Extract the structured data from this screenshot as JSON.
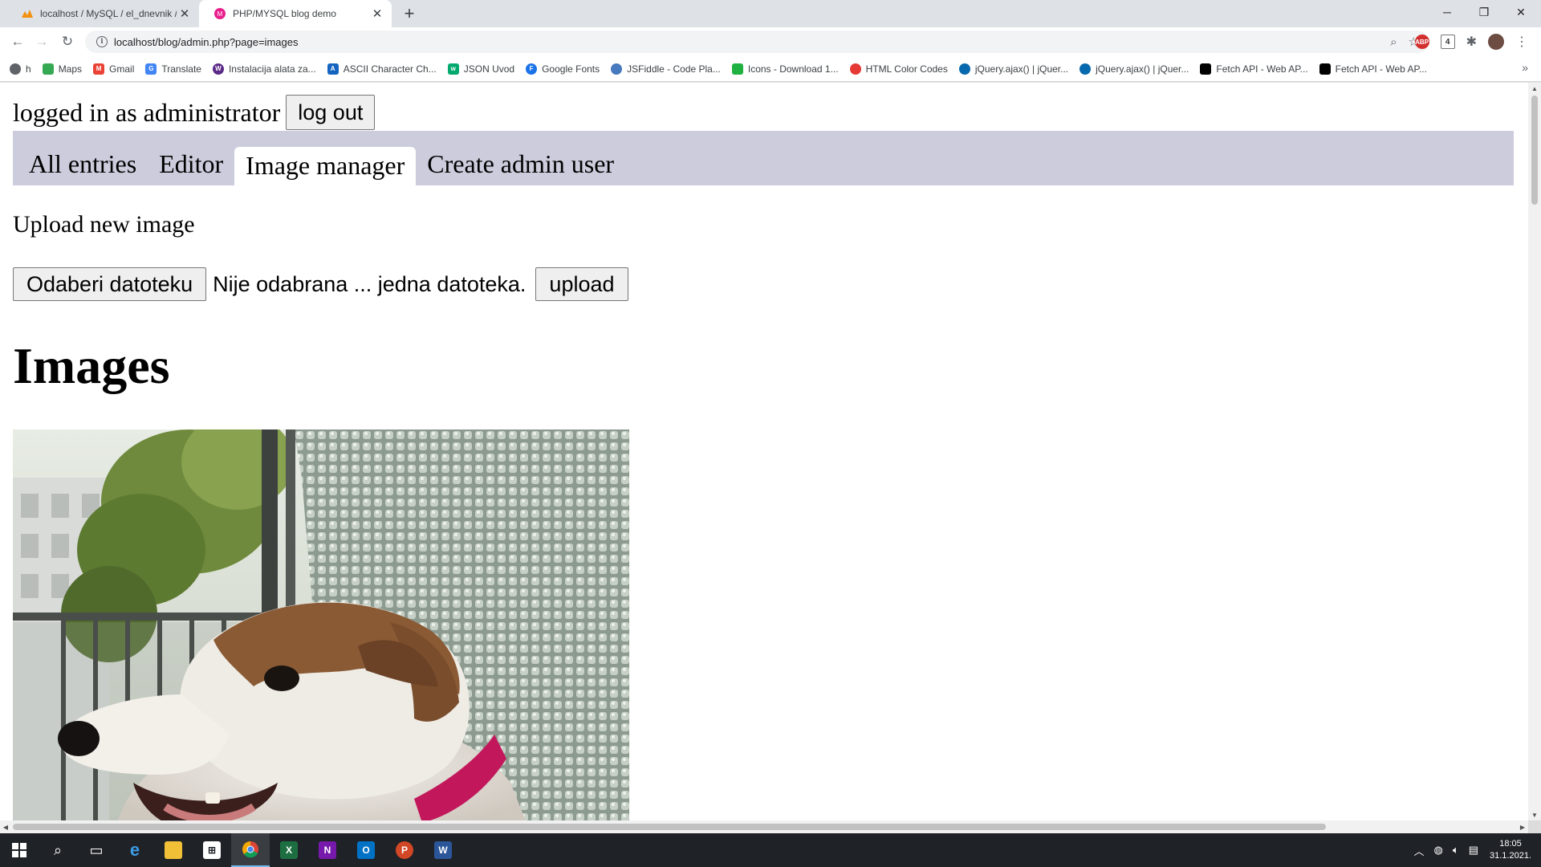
{
  "browser": {
    "tabs": [
      {
        "title": "localhost / MySQL / el_dnevnik /",
        "active": false
      },
      {
        "title": "PHP/MYSQL blog demo",
        "active": true
      }
    ],
    "url": "localhost/blog/admin.php?page=images",
    "bookmarks": [
      {
        "label": "h",
        "icon": "globe-icon",
        "color": "#5f6368"
      },
      {
        "label": "Maps",
        "icon": "maps-icon",
        "color": "#34a853"
      },
      {
        "label": "Gmail",
        "icon": "gmail-icon",
        "color": "#ea4335"
      },
      {
        "label": "Translate",
        "icon": "translate-icon",
        "color": "#4285f4"
      },
      {
        "label": "Instalacija alata za...",
        "icon": "wp-icon",
        "color": "#5b2a86"
      },
      {
        "label": "ASCII Character Ch...",
        "icon": "ascii-icon",
        "color": "#1565c0"
      },
      {
        "label": "JSON Uvod",
        "icon": "w3-icon",
        "color": "#04aa6d"
      },
      {
        "label": "Google Fonts",
        "icon": "google-fonts-icon",
        "color": "#1a73e8"
      },
      {
        "label": "JSFiddle - Code Pla...",
        "icon": "jsfiddle-icon",
        "color": "#4679bd"
      },
      {
        "label": "Icons - Download 1...",
        "icon": "icons8-icon",
        "color": "#1fb141"
      },
      {
        "label": "HTML Color Codes",
        "icon": "color-codes-icon",
        "color": "#e53935"
      },
      {
        "label": "jQuery.ajax() | jQuer...",
        "icon": "jquery-icon",
        "color": "#0769ad"
      },
      {
        "label": "jQuery.ajax() | jQuer...",
        "icon": "jquery-icon",
        "color": "#0769ad"
      },
      {
        "label": "Fetch API - Web AP...",
        "icon": "mdn-icon",
        "color": "#000000"
      },
      {
        "label": "Fetch API - Web AP...",
        "icon": "mdn-icon",
        "color": "#000000"
      }
    ],
    "extension_badge": "4"
  },
  "page": {
    "login_text": "logged in as administrator",
    "logout_label": "log out",
    "nav": [
      {
        "label": "All entries",
        "active": false
      },
      {
        "label": "Editor",
        "active": false
      },
      {
        "label": "Image manager",
        "active": true
      },
      {
        "label": "Create admin user",
        "active": false
      }
    ],
    "upload_heading": "Upload new image",
    "choose_file_label": "Odaberi datoteku",
    "no_file_text": "Nije odabrana ... jedna datoteka.",
    "upload_label": "upload",
    "images_heading": "Images"
  },
  "taskbar": {
    "time": "18:05",
    "date": "31.1.2021."
  },
  "colors": {
    "nav_bg": "#ccccdd",
    "tab_strip": "#dee1e6",
    "taskbar": "#1f2227"
  }
}
